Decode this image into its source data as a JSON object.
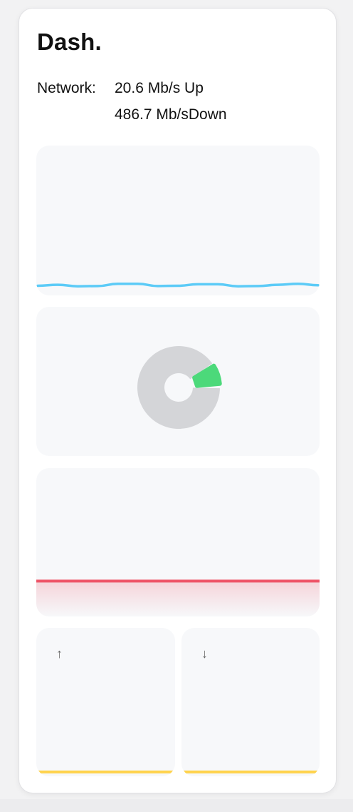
{
  "header": {
    "title": "Dash."
  },
  "network": {
    "label": "Network:",
    "up_text": "20.6 Mb/s Up",
    "down_text": "486.7 Mb/sDown"
  },
  "panels": {
    "network_sparkline": {
      "color": "#5ccbf7",
      "values": [
        1.0,
        1.4,
        0.8,
        0.9,
        1.8,
        1.8,
        0.9,
        1.0,
        1.6,
        1.6,
        0.8,
        0.9,
        1.4,
        1.8,
        1.2
      ]
    },
    "gauge": {
      "ring_color": "#d4d5d8",
      "active_color": "#4cd97a"
    },
    "memory_line": {
      "color": "#ee5467",
      "level": 0.2
    },
    "upload_card": {
      "icon": "arrow-up-icon",
      "glyph": "↑",
      "bar_color": "#ffd34d",
      "level": 0.02
    },
    "download_card": {
      "icon": "arrow-down-icon",
      "glyph": "↓",
      "bar_color": "#ffd34d",
      "level": 0.02
    }
  }
}
